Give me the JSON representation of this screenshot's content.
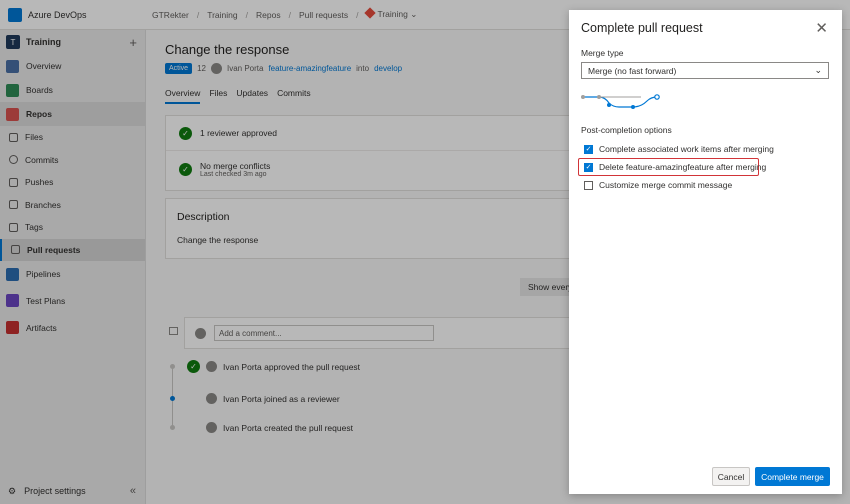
{
  "app": {
    "brand": "Azure DevOps"
  },
  "breadcrumb": [
    "GTRekter",
    "Training",
    "Repos",
    "Pull requests",
    "Training"
  ],
  "sidebar": {
    "project": {
      "initial": "T",
      "name": "Training"
    },
    "items": [
      {
        "label": "Overview",
        "color": "#4a6fa5"
      },
      {
        "label": "Boards",
        "color": "#2e8b57"
      },
      {
        "label": "Repos",
        "color": "#d9534f"
      },
      {
        "label": "Files"
      },
      {
        "label": "Commits"
      },
      {
        "label": "Pushes"
      },
      {
        "label": "Branches"
      },
      {
        "label": "Tags"
      },
      {
        "label": "Pull requests"
      },
      {
        "label": "Pipelines",
        "color": "#2b6cb0"
      },
      {
        "label": "Test Plans",
        "color": "#6b46c1"
      },
      {
        "label": "Artifacts",
        "color": "#c53030"
      }
    ],
    "footer": "Project settings"
  },
  "pr": {
    "title": "Change the response",
    "status": "Active",
    "id": "12",
    "author": "Ivan Porta",
    "source_branch": "feature-amazingfeature",
    "into": "into",
    "target_branch": "develop",
    "tabs": [
      "Overview",
      "Files",
      "Updates",
      "Commits"
    ],
    "reviewers_status": "1 reviewer approved",
    "merge_status": "No merge conflicts",
    "merge_checked": "Last checked 3m ago",
    "description_heading": "Description",
    "description_body": "Change the response",
    "show_button": "Show every",
    "comment_placeholder": "Add a comment...",
    "timeline": [
      "Ivan Porta approved the pull request",
      "Ivan Porta joined as a reviewer",
      "Ivan Porta created the pull request"
    ]
  },
  "dialog": {
    "title": "Complete pull request",
    "merge_type_label": "Merge type",
    "merge_type_value": "Merge (no fast forward)",
    "post_completion_label": "Post-completion options",
    "options": [
      {
        "label": "Complete associated work items after merging",
        "checked": true
      },
      {
        "label": "Delete feature-amazingfeature after merging",
        "checked": true
      },
      {
        "label": "Customize merge commit message",
        "checked": false
      }
    ],
    "cancel_label": "Cancel",
    "complete_label": "Complete merge"
  }
}
